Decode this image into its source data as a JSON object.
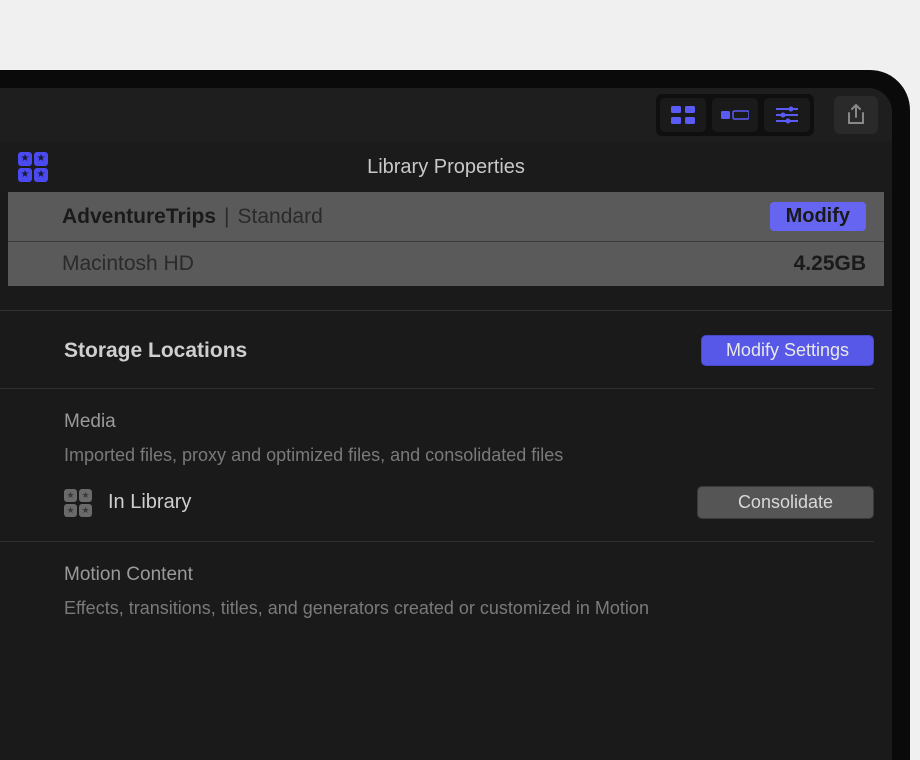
{
  "toolbar": {
    "view_grid_label": "Clip view",
    "view_list_label": "List view",
    "view_filter_label": "Filter/Inspector",
    "share_label": "Share"
  },
  "panel": {
    "title": "Library Properties",
    "library_name": "AdventureTrips",
    "separator": " | ",
    "library_mode": "Standard",
    "modify_label": "Modify",
    "disk_name": "Macintosh HD",
    "disk_size": "4.25GB"
  },
  "storage": {
    "title": "Storage Locations",
    "modify_settings_label": "Modify Settings",
    "media": {
      "title": "Media",
      "description": "Imported files, proxy and optimized files, and consolidated files",
      "location": "In Library",
      "consolidate_label": "Consolidate"
    },
    "motion": {
      "title": "Motion Content",
      "description": "Effects, transitions, titles, and generators created or customized in Motion"
    }
  }
}
